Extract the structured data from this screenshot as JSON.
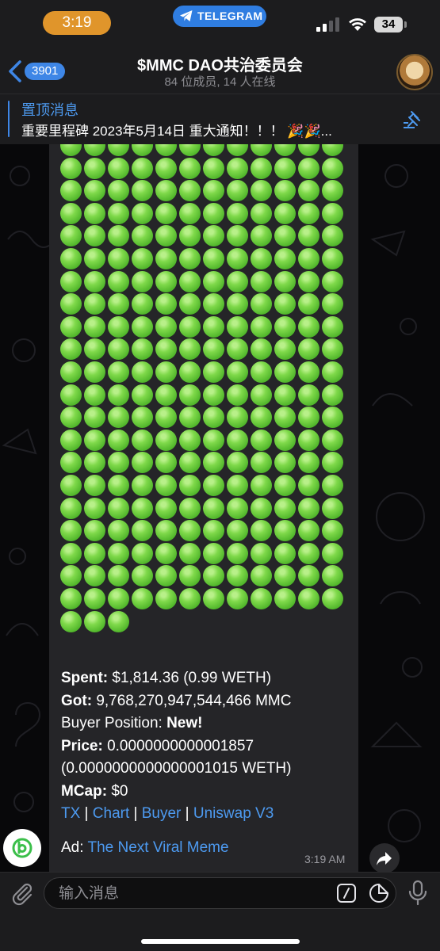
{
  "status_bar": {
    "time": "3:19",
    "app_pill": "TELEGRAM",
    "battery": "34"
  },
  "header": {
    "back_badge": "3901",
    "title": "$MMC DAO共治委员会",
    "subtitle": "84 位成员, 14 人在线"
  },
  "pinned": {
    "title": "置顶消息",
    "text": "重要里程碑 2023年5月14日 重大通知！！！ 🎉🎉..."
  },
  "message": {
    "dot_rows": 22,
    "dot_cols": 12,
    "last_row_count": 3,
    "spent_label": "Spent:",
    "spent_value": " $1,814.36 (0.99 WETH)",
    "got_label": "Got:",
    "got_value": " 9,768,270,947,544,466 MMC",
    "position_label": "Buyer Position: ",
    "position_value": "New!",
    "price_label": "Price:",
    "price_value": " 0.0000000000001857",
    "price_weth": "(0.0000000000000001015 WETH)",
    "mcap_label": "MCap:",
    "mcap_value": " $0",
    "links": [
      "TX",
      "Chart",
      "Buyer",
      "Uniswap V3"
    ],
    "separator": " | ",
    "ad_label": "Ad: ",
    "ad_link": "The Next Viral Meme",
    "time": "3:19 AM"
  },
  "input": {
    "placeholder": "输入消息"
  },
  "colors": {
    "accent": "#3e86e6",
    "link": "#4d9af0",
    "status_pill": "#e0952b",
    "dot_green": "#5cc233"
  }
}
